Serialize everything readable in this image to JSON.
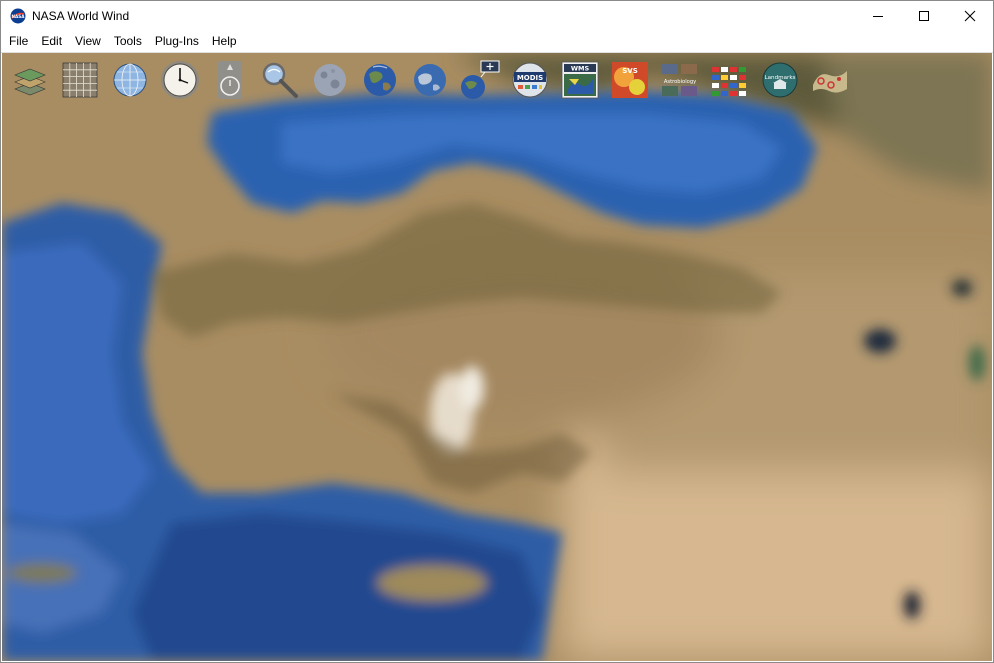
{
  "window": {
    "title": "NASA World Wind",
    "app_icon": "nasa-logo-icon",
    "controls": [
      "minimize-icon",
      "maximize-icon",
      "close-icon"
    ]
  },
  "menu": [
    "File",
    "Edit",
    "View",
    "Tools",
    "Plug-Ins",
    "Help"
  ],
  "toolbar": {
    "items": [
      {
        "name": "layer-manager-icon"
      },
      {
        "name": "lat-lon-grid-icon"
      },
      {
        "name": "globe-grid-icon"
      },
      {
        "name": "time-clock-icon"
      },
      {
        "name": "compass-icon"
      },
      {
        "name": "search-magnifier-icon"
      },
      {
        "name": "moon-icon"
      },
      {
        "name": "earth-icon"
      },
      {
        "name": "earth-night-icon"
      },
      {
        "name": "add-placemark-icon"
      },
      {
        "name": "modis-icon",
        "label": "MODIS"
      },
      {
        "name": "wms-icon",
        "label": "WMS"
      },
      {
        "name": "svs-icon",
        "label": "SVS"
      },
      {
        "name": "astrobiology-icon",
        "label": "Astrobiology"
      },
      {
        "name": "flags-icon"
      },
      {
        "name": "landmarks-icon",
        "label": "Landmarks"
      },
      {
        "name": "places-icon"
      }
    ]
  },
  "colors": {
    "sea": "#2f5ea6",
    "land": "#a5895f",
    "desert": "#d3b58e"
  }
}
